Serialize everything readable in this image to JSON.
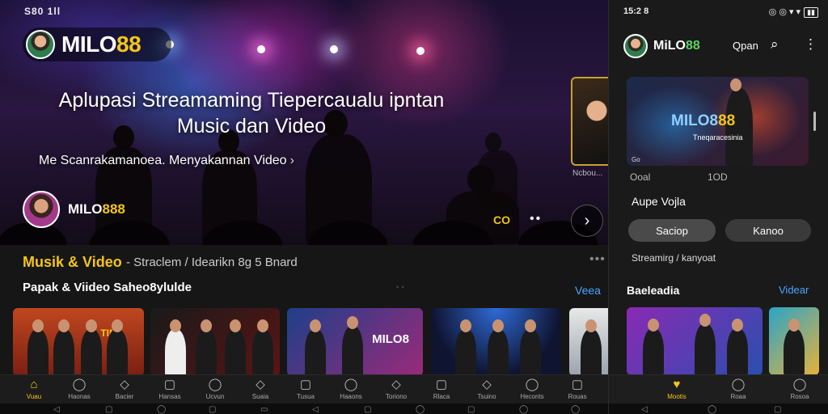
{
  "left": {
    "status_time": "S80 1ll",
    "logo": {
      "main": "MILO",
      "accent": "88"
    },
    "hero": {
      "title_line1": "Aplupasi Streamaming Tiepercaualu ipntan",
      "title_line2": "Music dan Video",
      "subtitle": "Me  Scanrakamanoea. Menyakannan Video",
      "subtitle_arrow": "›",
      "user_main": "MILO",
      "user_accent": "888",
      "co_label": "CO",
      "dots": "••",
      "next_icon": "›",
      "side_thumb_label": "Ncbou..."
    },
    "section1": {
      "title": "Musik & Video",
      "subtitle": "- Straclem / Idearikn 8g 5 Bnard",
      "more": "•••"
    },
    "section2": {
      "title": "Papak & Viideo Saheo8ylulde",
      "dots": "◦ ◦",
      "link": "Veea"
    },
    "cards": [
      {
        "title": "TIMe"
      },
      {
        "title": ""
      },
      {
        "title": "MILO8"
      },
      {
        "title": ""
      }
    ],
    "nav": [
      {
        "label": "Vuau",
        "icon": "⌂",
        "active": true
      },
      {
        "label": "Haonas",
        "icon": "◯"
      },
      {
        "label": "Bacier",
        "icon": "◇"
      },
      {
        "label": "Hansas",
        "icon": "▢"
      },
      {
        "label": "Ucvun",
        "icon": "◯"
      },
      {
        "label": "Suaia",
        "icon": "◇"
      },
      {
        "label": "Tusua",
        "icon": "▢"
      },
      {
        "label": "Haaons",
        "icon": "◯"
      },
      {
        "label": "Toriono",
        "icon": "◇"
      },
      {
        "label": "Rlaca",
        "icon": "▢"
      },
      {
        "label": "Tsuino",
        "icon": "◇"
      },
      {
        "label": "Heconts",
        "icon": "◯"
      },
      {
        "label": "Rouas",
        "icon": "▢"
      }
    ],
    "sys_buttons": [
      "◁",
      "▢",
      "◯",
      "▢",
      "▭",
      "◁",
      "▢",
      "◯",
      "▢",
      "◯",
      "◯"
    ]
  },
  "right": {
    "status_time": "15:2 8",
    "status_icons": "◎ ◎ ▾ ▾",
    "battery": "▮▮",
    "logo": {
      "main": "MiLO",
      "accent": "88"
    },
    "open_label": "Qpan",
    "search_icon": "⌕",
    "kebab_icon": "⋮",
    "banner": {
      "title_main": "MILO8",
      "title_accent": "88",
      "subtitle": "Tneqaracesinia",
      "badge": "Go"
    },
    "meta1": "Ooal",
    "meta2": "1OD",
    "heading": "Aupe Vojla",
    "buttons": [
      "Saciop",
      "Kanoo"
    ],
    "streaming": "Streamirg / kanyoat",
    "section": {
      "title": "Baeleadia",
      "link": "Videar"
    },
    "cards": [
      {
        "title": ""
      },
      {
        "title": ""
      }
    ],
    "nav": [
      {
        "label": "Mootis",
        "icon": "♥",
        "active": true
      },
      {
        "label": "Roaa",
        "icon": "◯"
      },
      {
        "label": "Rosoa",
        "icon": "◯"
      }
    ],
    "sys_buttons": [
      "◁",
      "◯",
      "▢"
    ]
  },
  "colors": {
    "accent_yellow": "#f5c518",
    "link_blue": "#4aa3ff",
    "logo_green": "#5fd35f"
  }
}
